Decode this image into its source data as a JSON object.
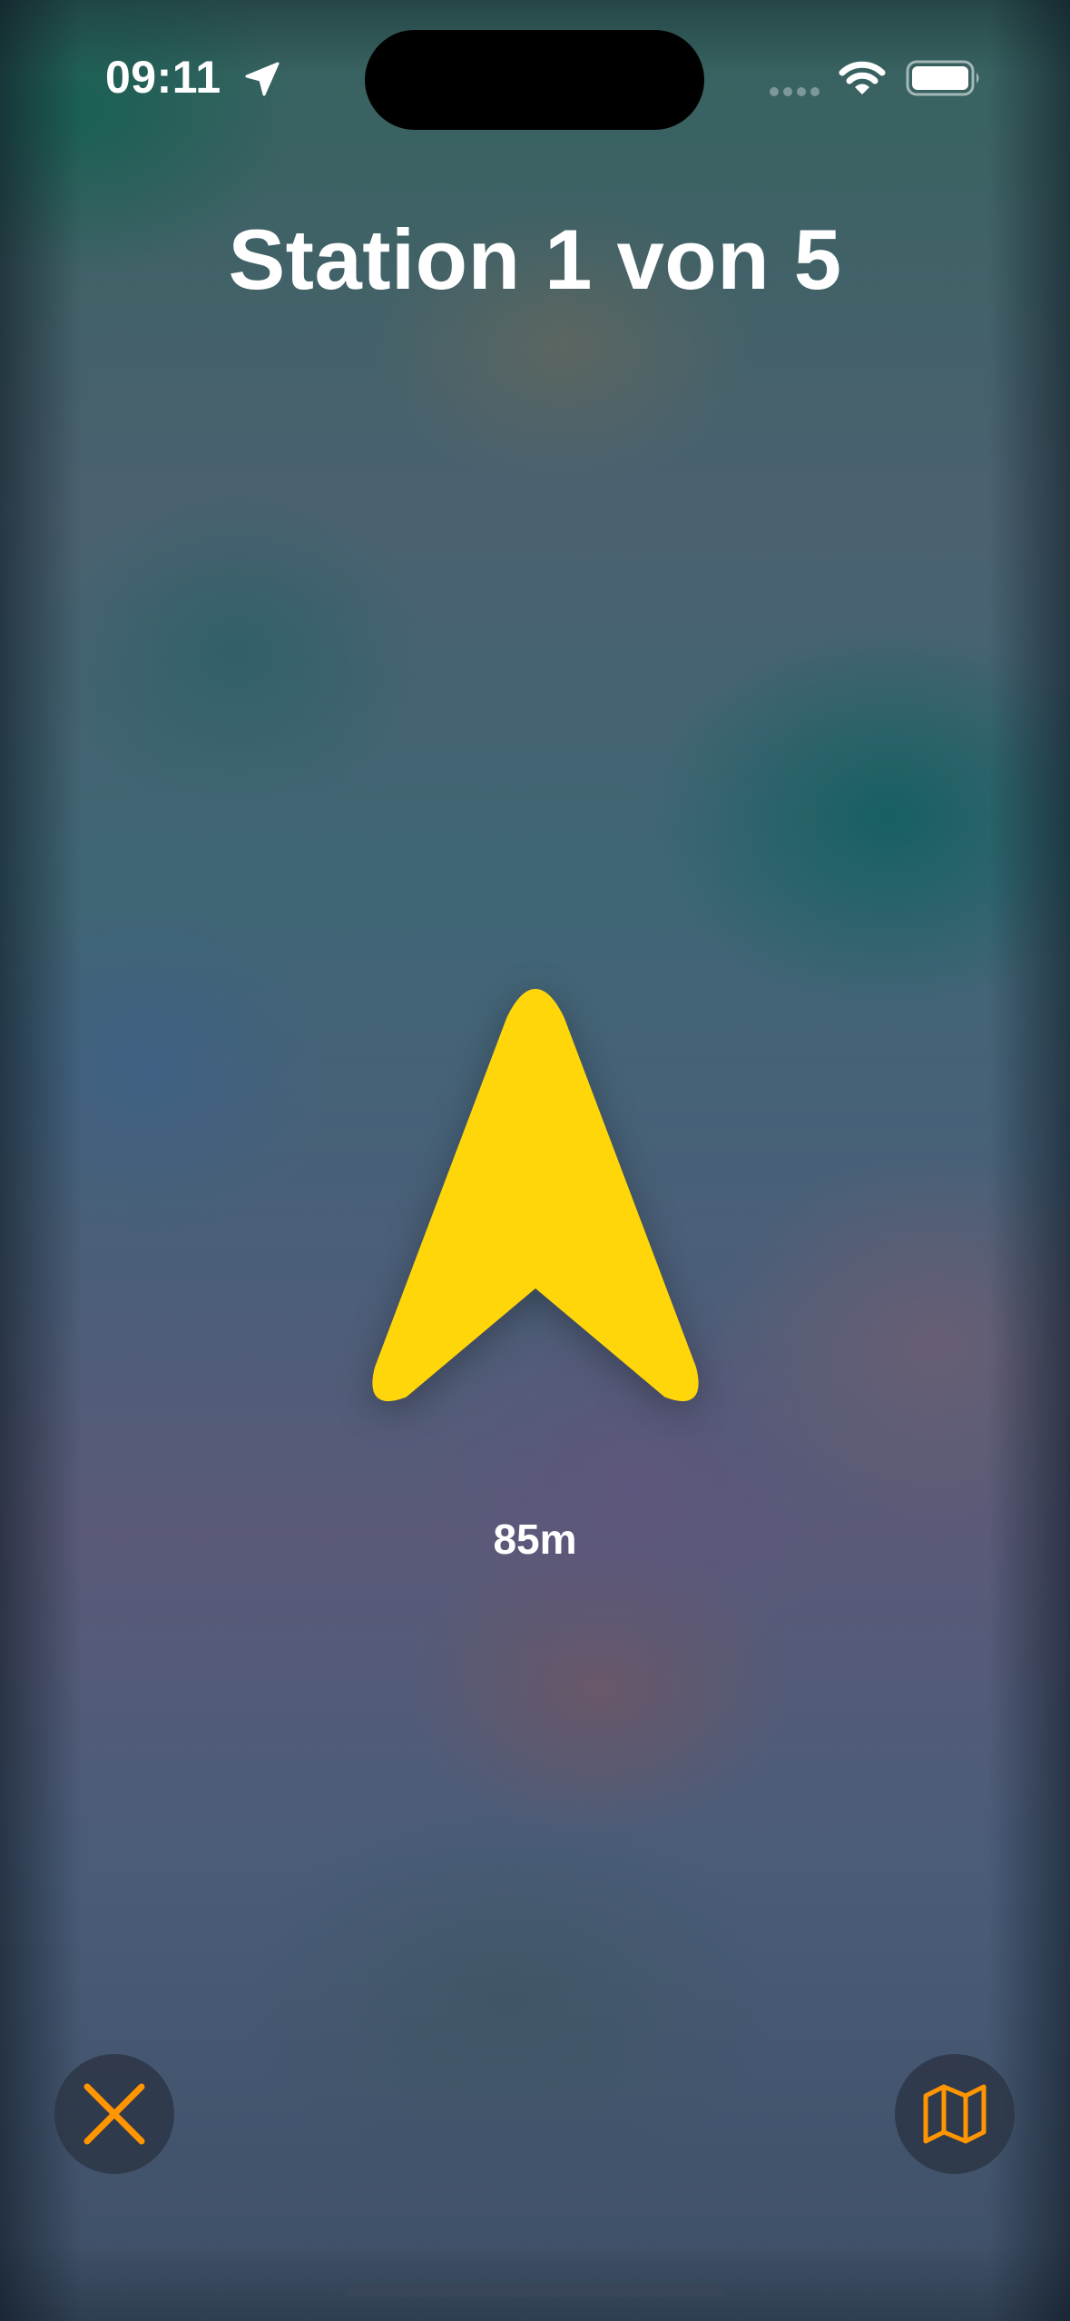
{
  "status_bar": {
    "time": "09:11",
    "icons": [
      "location-arrow-icon",
      "cellular-signal-icon",
      "wifi-icon",
      "battery-icon"
    ]
  },
  "navigation": {
    "title": "Station 1 von 5",
    "distance": "85m",
    "direction_icon": "direction-arrow-icon",
    "arrow_color": "#FFD60A"
  },
  "controls": {
    "close_icon": "close-icon",
    "map_icon": "map-icon",
    "accent_color": "#FF9500"
  }
}
